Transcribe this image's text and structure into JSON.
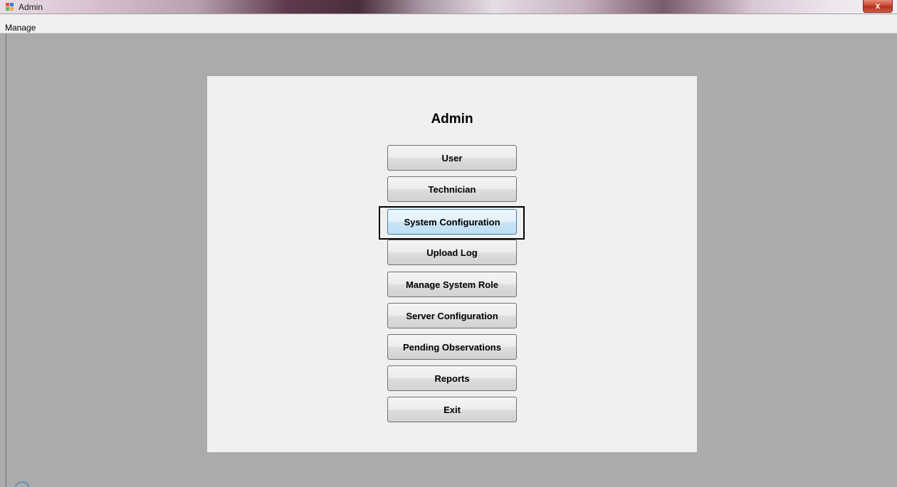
{
  "window": {
    "title": "Admin",
    "close_label": "x"
  },
  "menu": {
    "items": [
      "Manage"
    ]
  },
  "panel": {
    "heading": "Admin",
    "buttons": [
      {
        "label": "User"
      },
      {
        "label": "Technician"
      },
      {
        "label": "System Configuration",
        "focused": true
      },
      {
        "label": "Upload Log"
      },
      {
        "label": "Manage System Role"
      },
      {
        "label": "Server Configuration"
      },
      {
        "label": "Pending Observations"
      },
      {
        "label": "Reports"
      },
      {
        "label": "Exit"
      }
    ]
  },
  "colors": {
    "workspace_bg": "#ababab",
    "panel_bg": "#f0f0f0",
    "focus_border": "#3c7fb1",
    "highlight_box": "#000000"
  }
}
